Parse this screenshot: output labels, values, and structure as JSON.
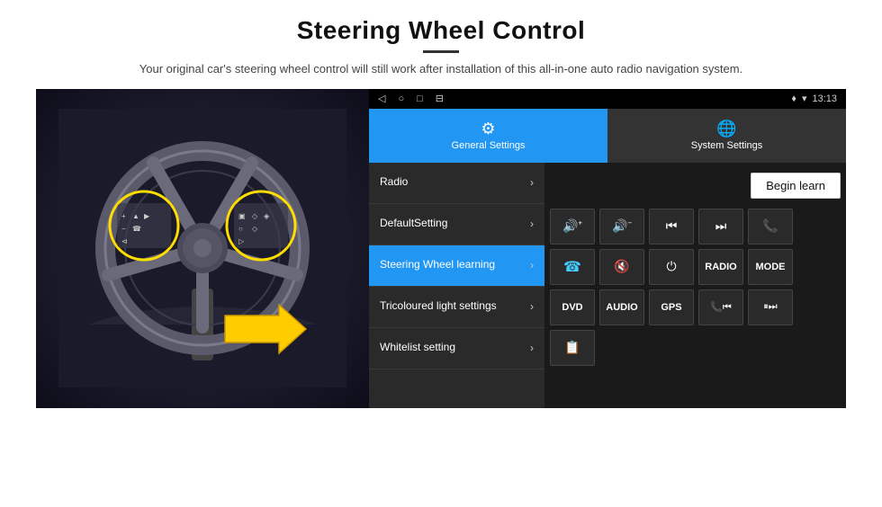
{
  "header": {
    "title": "Steering Wheel Control",
    "subtitle": "Your original car's steering wheel control will still work after installation of this all-in-one auto radio navigation system."
  },
  "tabs": [
    {
      "id": "general",
      "label": "General Settings",
      "active": true,
      "icon": "⚙"
    },
    {
      "id": "system",
      "label": "System Settings",
      "active": false,
      "icon": "🌐"
    }
  ],
  "status_bar": {
    "nav_icons": [
      "◁",
      "○",
      "□",
      "⊟"
    ],
    "right": "♦ ▾ 13:13"
  },
  "menu_items": [
    {
      "label": "Radio",
      "active": false
    },
    {
      "label": "DefaultSetting",
      "active": false
    },
    {
      "label": "Steering Wheel learning",
      "active": true
    },
    {
      "label": "Tricoloured light settings",
      "active": false
    },
    {
      "label": "Whitelist setting",
      "active": false
    }
  ],
  "controls": {
    "begin_learn": "Begin learn",
    "row1": [
      "🔊+",
      "🔊-",
      "⏮",
      "⏭",
      "📞"
    ],
    "row2": [
      "📞",
      "🔇",
      "⏻",
      "RADIO",
      "MODE"
    ],
    "row3": [
      "DVD",
      "AUDIO",
      "GPS",
      "📞⏮",
      "⏸⏭"
    ],
    "row4_icon": "📋"
  }
}
